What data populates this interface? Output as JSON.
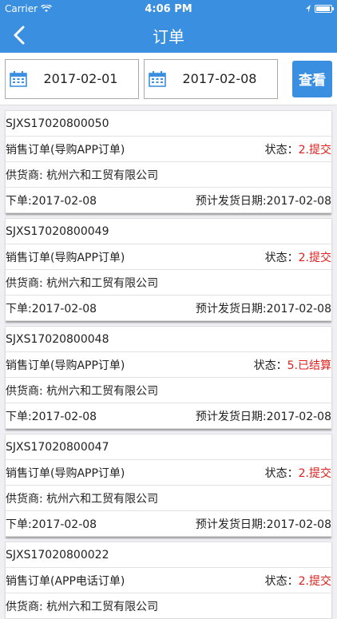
{
  "status_bar": {
    "carrier": "Carrier",
    "time": "4:06 PM"
  },
  "nav": {
    "title": "订单"
  },
  "filter": {
    "start_date": "2017-02-01",
    "end_date": "2017-02-08",
    "view_label": "查看"
  },
  "labels": {
    "status": "状态：",
    "supplier_prefix": "供货商: ",
    "order_prefix": "下单:",
    "ship_prefix": "预计发货日期:"
  },
  "orders": [
    {
      "id": "SJXS17020800050",
      "type": "销售订单(导购APP订单)",
      "status": "2.提交",
      "supplier": "杭州六和工贸有限公司",
      "order_date": "2017-02-08",
      "ship_date": "2017-02-08"
    },
    {
      "id": "SJXS17020800049",
      "type": "销售订单(导购APP订单)",
      "status": "2.提交",
      "supplier": "杭州六和工贸有限公司",
      "order_date": "2017-02-08",
      "ship_date": "2017-02-08"
    },
    {
      "id": "SJXS17020800048",
      "type": "销售订单(导购APP订单)",
      "status": "5.已结算",
      "supplier": "杭州六和工贸有限公司",
      "order_date": "2017-02-08",
      "ship_date": "2017-02-08"
    },
    {
      "id": "SJXS17020800047",
      "type": "销售订单(导购APP订单)",
      "status": "2.提交",
      "supplier": "杭州六和工贸有限公司",
      "order_date": "2017-02-08",
      "ship_date": "2017-02-08"
    },
    {
      "id": "SJXS17020800022",
      "type": "销售订单(APP电话订单)",
      "status": "2.提交",
      "supplier": "杭州六和工贸有限公司",
      "order_date": "",
      "ship_date": ""
    }
  ]
}
